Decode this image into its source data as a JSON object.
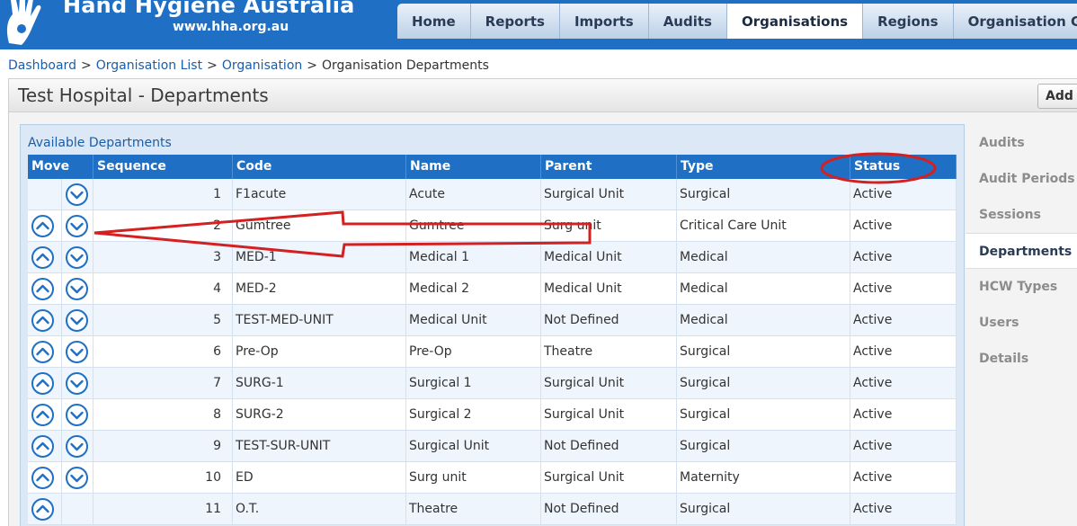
{
  "header": {
    "logo_name": "Hand Hygiene Australia",
    "logo_url": "www.hha.org.au",
    "nav": [
      {
        "label": "Home",
        "name": "nav-home",
        "active": false
      },
      {
        "label": "Reports",
        "name": "nav-reports",
        "active": false
      },
      {
        "label": "Imports",
        "name": "nav-imports",
        "active": false
      },
      {
        "label": "Audits",
        "name": "nav-audits",
        "active": false
      },
      {
        "label": "Organisations",
        "name": "nav-organisations",
        "active": true
      },
      {
        "label": "Regions",
        "name": "nav-regions",
        "active": false
      },
      {
        "label": "Organisation Groups",
        "name": "nav-organisation-groups",
        "active": false
      }
    ]
  },
  "breadcrumb": {
    "items": [
      "Dashboard",
      "Organisation List",
      "Organisation"
    ],
    "current": "Organisation Departments",
    "separator": ">"
  },
  "page": {
    "title": "Test Hospital - Departments",
    "add_button_label": "Add Department"
  },
  "table": {
    "caption": "Available Departments",
    "columns": [
      "Move",
      "Sequence",
      "Code",
      "Name",
      "Parent",
      "Type",
      "Status"
    ],
    "rows": [
      {
        "up": false,
        "down": true,
        "seq": "1",
        "code": "F1acute",
        "name": "Acute",
        "parent": "Surgical Unit",
        "type": "Surgical",
        "status": "Active"
      },
      {
        "up": true,
        "down": true,
        "seq": "2",
        "code": "Gumtree",
        "name": "Gumtree",
        "parent": "Surg unit",
        "type": "Critical Care Unit",
        "status": "Active"
      },
      {
        "up": true,
        "down": true,
        "seq": "3",
        "code": "MED-1",
        "name": "Medical 1",
        "parent": "Medical Unit",
        "type": "Medical",
        "status": "Active"
      },
      {
        "up": true,
        "down": true,
        "seq": "4",
        "code": "MED-2",
        "name": "Medical 2",
        "parent": "Medical Unit",
        "type": "Medical",
        "status": "Active"
      },
      {
        "up": true,
        "down": true,
        "seq": "5",
        "code": "TEST-MED-UNIT",
        "name": "Medical Unit",
        "parent": "Not Defined",
        "type": "Medical",
        "status": "Active"
      },
      {
        "up": true,
        "down": true,
        "seq": "6",
        "code": "Pre-Op",
        "name": "Pre-Op",
        "parent": "Theatre",
        "type": "Surgical",
        "status": "Active"
      },
      {
        "up": true,
        "down": true,
        "seq": "7",
        "code": "SURG-1",
        "name": "Surgical 1",
        "parent": "Surgical Unit",
        "type": "Surgical",
        "status": "Active"
      },
      {
        "up": true,
        "down": true,
        "seq": "8",
        "code": "SURG-2",
        "name": "Surgical 2",
        "parent": "Surgical Unit",
        "type": "Surgical",
        "status": "Active"
      },
      {
        "up": true,
        "down": true,
        "seq": "9",
        "code": "TEST-SUR-UNIT",
        "name": "Surgical Unit",
        "parent": "Not Defined",
        "type": "Surgical",
        "status": "Active"
      },
      {
        "up": true,
        "down": true,
        "seq": "10",
        "code": "ED",
        "name": "Surg unit",
        "parent": "Surgical Unit",
        "type": "Maternity",
        "status": "Active"
      },
      {
        "up": true,
        "down": false,
        "seq": "11",
        "code": "O.T.",
        "name": "Theatre",
        "parent": "Not Defined",
        "type": "Surgical",
        "status": "Active"
      }
    ]
  },
  "side_menu": {
    "items": [
      {
        "label": "Audits",
        "name": "side-audits",
        "active": false
      },
      {
        "label": "Audit Periods",
        "name": "side-audit-periods",
        "active": false
      },
      {
        "label": "Sessions",
        "name": "side-sessions",
        "active": false
      },
      {
        "label": "Departments",
        "name": "side-departments",
        "active": true
      },
      {
        "label": "HCW Types",
        "name": "side-hcw-types",
        "active": false
      },
      {
        "label": "Users",
        "name": "side-users",
        "active": false
      },
      {
        "label": "Details",
        "name": "side-details",
        "active": false
      }
    ]
  },
  "colors": {
    "header_blue": "#1f6fc4",
    "link_blue": "#1c5da8",
    "move_icon_blue": "#1f6fc4",
    "annotation_red": "#d42020"
  },
  "icons": {
    "move_up": "chevron-up-circle-icon",
    "move_down": "chevron-down-circle-icon"
  }
}
